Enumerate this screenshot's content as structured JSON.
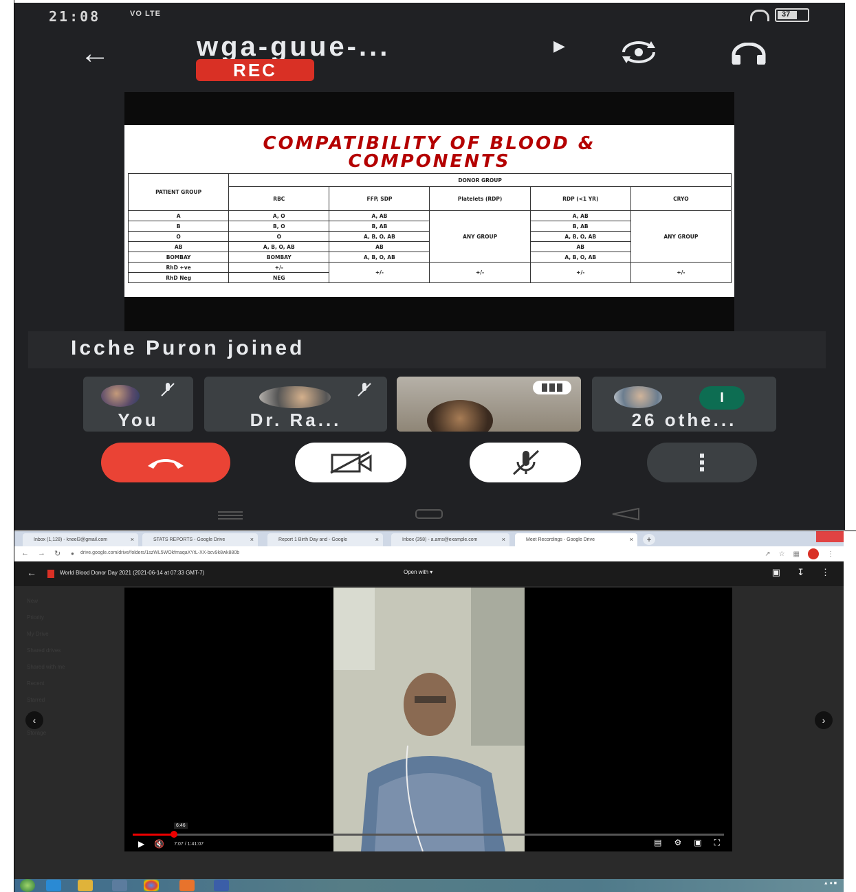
{
  "phone": {
    "status_time": "21:08",
    "status_signal": "VO LTE",
    "battery_level": "37",
    "meeting_title": "wga-guue-...",
    "rec_label": "REC",
    "slide": {
      "title_line1": "COMPATIBILITY OF BLOOD &",
      "title_line2": "COMPONENTS",
      "header_patient": "PATIENT GROUP",
      "header_donor": "DONOR GROUP",
      "columns": [
        "RBC",
        "FFP, SDP",
        "Platelets (RDP)",
        "RDP (<1 YR)",
        "CRYO"
      ],
      "rows": [
        {
          "patient": "A",
          "rbc": "A, O",
          "ffp": "A, AB",
          "rdp1": "A, AB"
        },
        {
          "patient": "B",
          "rbc": "B, O",
          "ffp": "B, AB",
          "rdp1": "B, AB"
        },
        {
          "patient": "O",
          "rbc": "O",
          "ffp": "A, B, O, AB",
          "rdp1": "A, B, O, AB"
        },
        {
          "patient": "AB",
          "rbc": "A, B, O, AB",
          "ffp": "AB",
          "rdp1": "AB"
        },
        {
          "patient": "BOMBAY",
          "rbc": "BOMBAY",
          "ffp": "A, B, O, AB",
          "rdp1": "A, B, O, AB"
        },
        {
          "patient": "RhD +ve",
          "rbc": "+/-"
        },
        {
          "patient": "RhD Neg",
          "rbc": "NEG"
        }
      ],
      "any_group": "ANY GROUP",
      "pm": "+/-"
    },
    "toast": "Icche Puron joined",
    "participants": [
      {
        "name": "You"
      },
      {
        "name": "Dr. Ra..."
      },
      {
        "name": ""
      },
      {
        "name": "26 othe..."
      }
    ],
    "others_count": "I"
  },
  "browser": {
    "tabs": [
      {
        "label": "Inbox (1,128) - kneel3@gmail.com"
      },
      {
        "label": "STATS REPORTS - Google Drive"
      },
      {
        "label": "Report 1 Birth Day and - Google"
      },
      {
        "label": "Inbox (358) - a.ams@example.com"
      },
      {
        "label": "Meet Recordings - Google Drive"
      }
    ],
    "url": "drive.google.com/drive/folders/1szWL5WOkfmaqaXYtL-XX-bcv9k8wk880b",
    "viewer_title": "World Blood Donor Day 2021 (2021-06-14 at 07:33 GMT-7)",
    "open_with": "Open with",
    "player": {
      "hover_time": "6:46",
      "time_display": "7:07 / 1:41:07",
      "progress_fraction": 0.07
    },
    "sidebar_ghost": [
      "New",
      "Priority",
      "My Drive",
      "Shared drives",
      "Shared with me",
      "Recent",
      "Starred",
      "Trash",
      "Storage"
    ]
  }
}
